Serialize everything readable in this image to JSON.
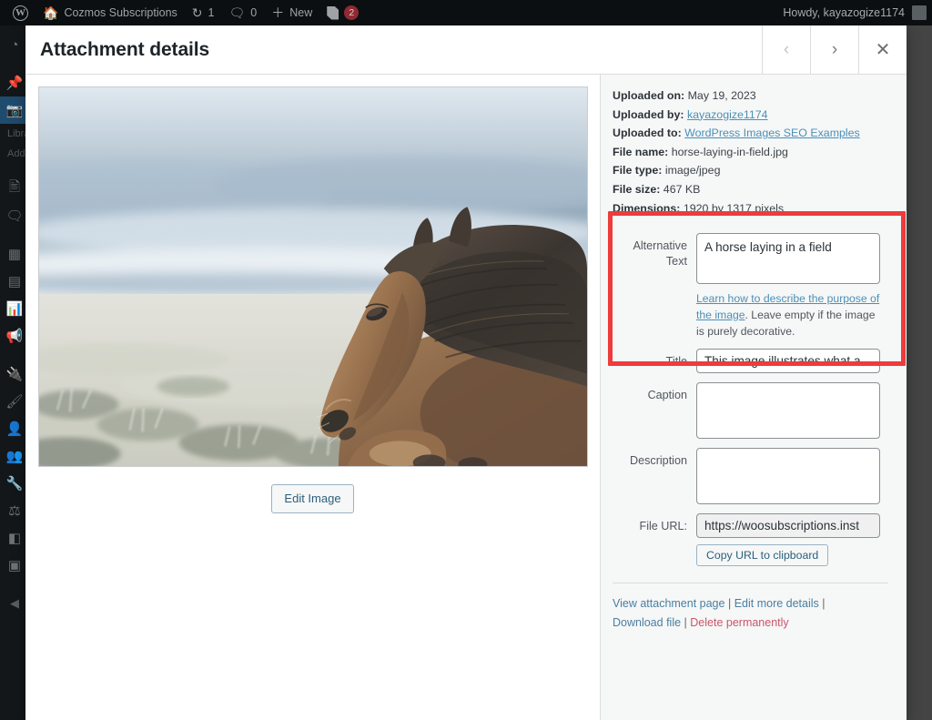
{
  "adminbar": {
    "wp_logo": "wordpress-logo",
    "site_name": "Cozmos Subscriptions",
    "updates_count": "1",
    "comments_count": "0",
    "new_label": "New",
    "yoast_badge": "2",
    "howdy": "Howdy, kayazogize1174"
  },
  "adminmenu": {
    "items": [
      {
        "name": "dashboard",
        "glyph": "◔"
      },
      {
        "name": "posts",
        "glyph": "✒"
      },
      {
        "name": "media",
        "glyph": "☉",
        "current": true
      },
      {
        "name": "pages",
        "glyph": "❐"
      },
      {
        "name": "comments",
        "glyph": "⌨"
      },
      {
        "name": "woocommerce",
        "glyph": "⌸"
      },
      {
        "name": "products",
        "glyph": "▤"
      },
      {
        "name": "analytics",
        "glyph": "█"
      },
      {
        "name": "marketing",
        "glyph": "✉"
      },
      {
        "name": "plugins",
        "glyph": "⚒"
      },
      {
        "name": "appearance",
        "glyph": "✎"
      },
      {
        "name": "users",
        "glyph": "☻"
      },
      {
        "name": "profile",
        "glyph": "☺"
      },
      {
        "name": "tools",
        "glyph": "⚒"
      },
      {
        "name": "settings",
        "glyph": "⊞"
      },
      {
        "name": "yoast-seo",
        "glyph": "◧"
      },
      {
        "name": "custom-plugin",
        "glyph": "▣"
      }
    ],
    "submenu": [
      {
        "label": "Library"
      },
      {
        "label": "Add New"
      }
    ],
    "collapse_label": "◀"
  },
  "modal": {
    "title": "Attachment details",
    "prev_label": "‹",
    "next_label": "›",
    "close_label": "✕"
  },
  "preview": {
    "alt_description": "A brown Icelandic horse with a dark mane laying in a frosty field",
    "edit_image_label": "Edit Image"
  },
  "meta": {
    "uploaded_on_label": "Uploaded on:",
    "uploaded_on_value": "May 19, 2023",
    "uploaded_by_label": "Uploaded by:",
    "uploaded_by_value": "kayazogize1174",
    "uploaded_to_label": "Uploaded to:",
    "uploaded_to_value": "WordPress Images SEO Examples",
    "file_name_label": "File name:",
    "file_name_value": "horse-laying-in-field.jpg",
    "file_type_label": "File type:",
    "file_type_value": "image/jpeg",
    "file_size_label": "File size:",
    "file_size_value": "467 KB",
    "dimensions_label": "Dimensions:",
    "dimensions_value": "1920 by 1317 pixels"
  },
  "fields": {
    "alt_text_label": "Alternative Text",
    "alt_text_value": "A horse laying in a field",
    "alt_help_link": "Learn how to describe the purpose of the image",
    "alt_help_rest": ". Leave empty if the image is purely decorative.",
    "title_label": "Title",
    "title_value": "This image illustrates what a",
    "caption_label": "Caption",
    "caption_value": "",
    "description_label": "Description",
    "description_value": "",
    "file_url_label": "File URL:",
    "file_url_value": "https://woosubscriptions.inst",
    "copy_url_label": "Copy URL to clipboard"
  },
  "actions": {
    "view_attachment": "View attachment page",
    "edit_more": "Edit more details",
    "download_file": "Download file",
    "delete_permanently": "Delete permanently",
    "separator": "|"
  },
  "colors": {
    "highlight": "#ee3b3b",
    "link": "#4a90b8",
    "danger": "#c9566b",
    "panel_bg": "#f6f7f7",
    "overlay": "#444444"
  }
}
